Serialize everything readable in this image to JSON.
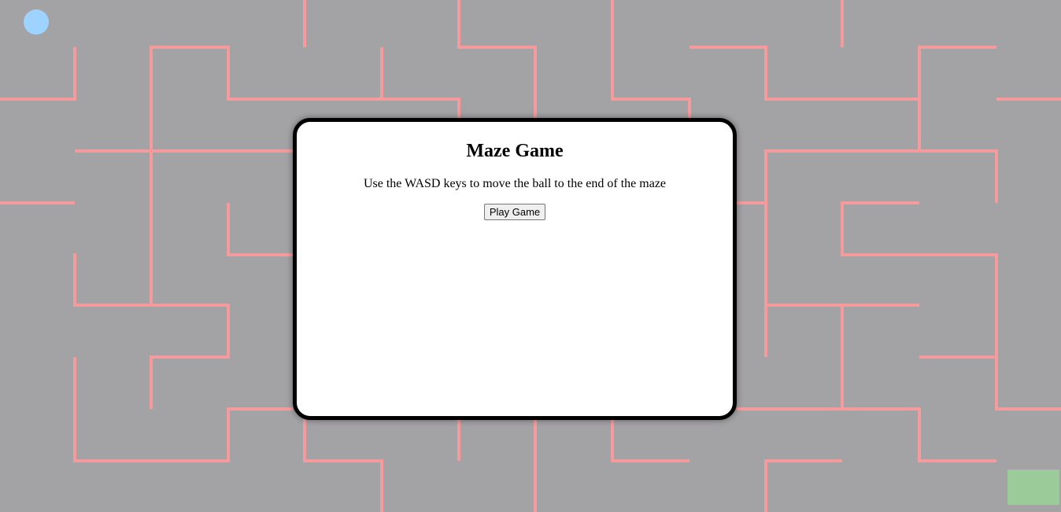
{
  "dialog": {
    "title": "Maze Game",
    "instructions": "Use the WASD keys to move the ball to the end of the maze",
    "play_label": "Play Game"
  },
  "colors": {
    "background": "#a3a2a5",
    "walls": "#f59b9d",
    "ball": "#9fd3ff",
    "goal": "#9acb98",
    "dialog_border": "#000000"
  }
}
